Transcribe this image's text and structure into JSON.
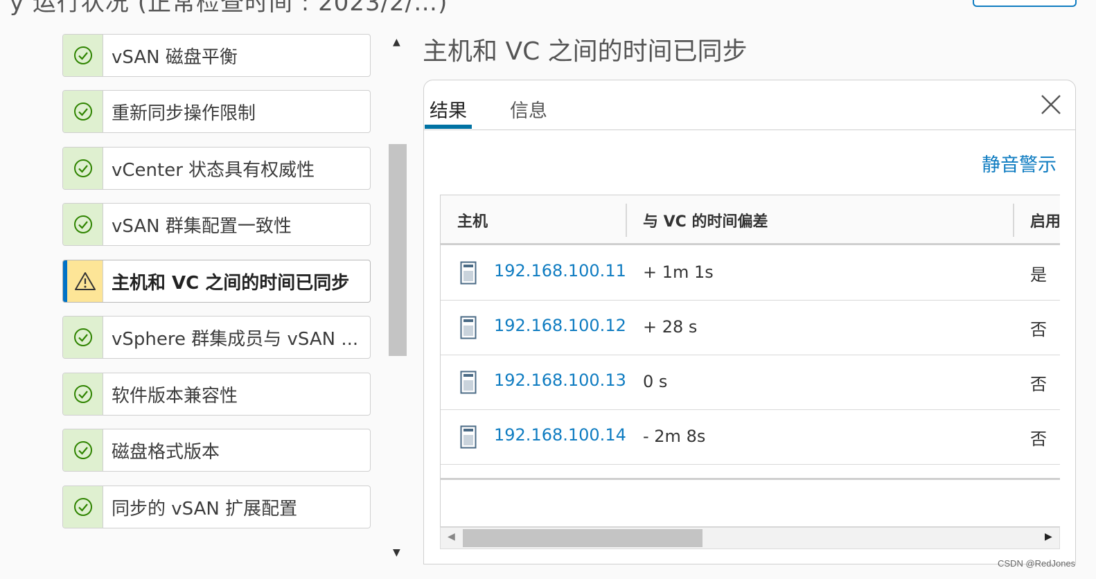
{
  "header": {
    "title_fragment": "y 运行状况 (正常检查时间 : 2023/2/…)"
  },
  "check_list": {
    "items": [
      {
        "label": "vSAN 磁盘平衡",
        "status": "ok"
      },
      {
        "label": "重新同步操作限制",
        "status": "ok"
      },
      {
        "label": "vCenter 状态具有权威性",
        "status": "ok"
      },
      {
        "label": "vSAN 群集配置一致性",
        "status": "ok"
      },
      {
        "label": "主机和 VC 之间的时间已同步",
        "status": "warning",
        "selected": true
      },
      {
        "label": "vSphere 群集成员与 vSAN ...",
        "status": "ok"
      },
      {
        "label": "软件版本兼容性",
        "status": "ok"
      },
      {
        "label": "磁盘格式版本",
        "status": "ok"
      },
      {
        "label": "同步的 vSAN 扩展配置",
        "status": "ok"
      }
    ]
  },
  "detail": {
    "title": "主机和 VC 之间的时间已同步",
    "tabs": [
      {
        "label": "结果",
        "active": true
      },
      {
        "label": "信息",
        "active": false
      }
    ],
    "mute_link": "静音警示",
    "grid": {
      "columns": [
        "主机",
        "与 VC 的时间偏差",
        "启用"
      ],
      "rows": [
        {
          "host": "192.168.100.11",
          "offset": "+ 1m 1s",
          "enabled": "是"
        },
        {
          "host": "192.168.100.12",
          "offset": "+ 28 s",
          "enabled": "否"
        },
        {
          "host": "192.168.100.13",
          "offset": "0 s",
          "enabled": "否"
        },
        {
          "host": "192.168.100.14",
          "offset": "- 2m 8s",
          "enabled": "否"
        }
      ]
    }
  },
  "colors": {
    "accent": "#0072a3",
    "link": "#0f7cc1",
    "ok_bg": "#dff0d0",
    "ok_icon": "#2f8400",
    "warn_bg": "#fde597"
  },
  "watermark": "CSDN @RedJones"
}
